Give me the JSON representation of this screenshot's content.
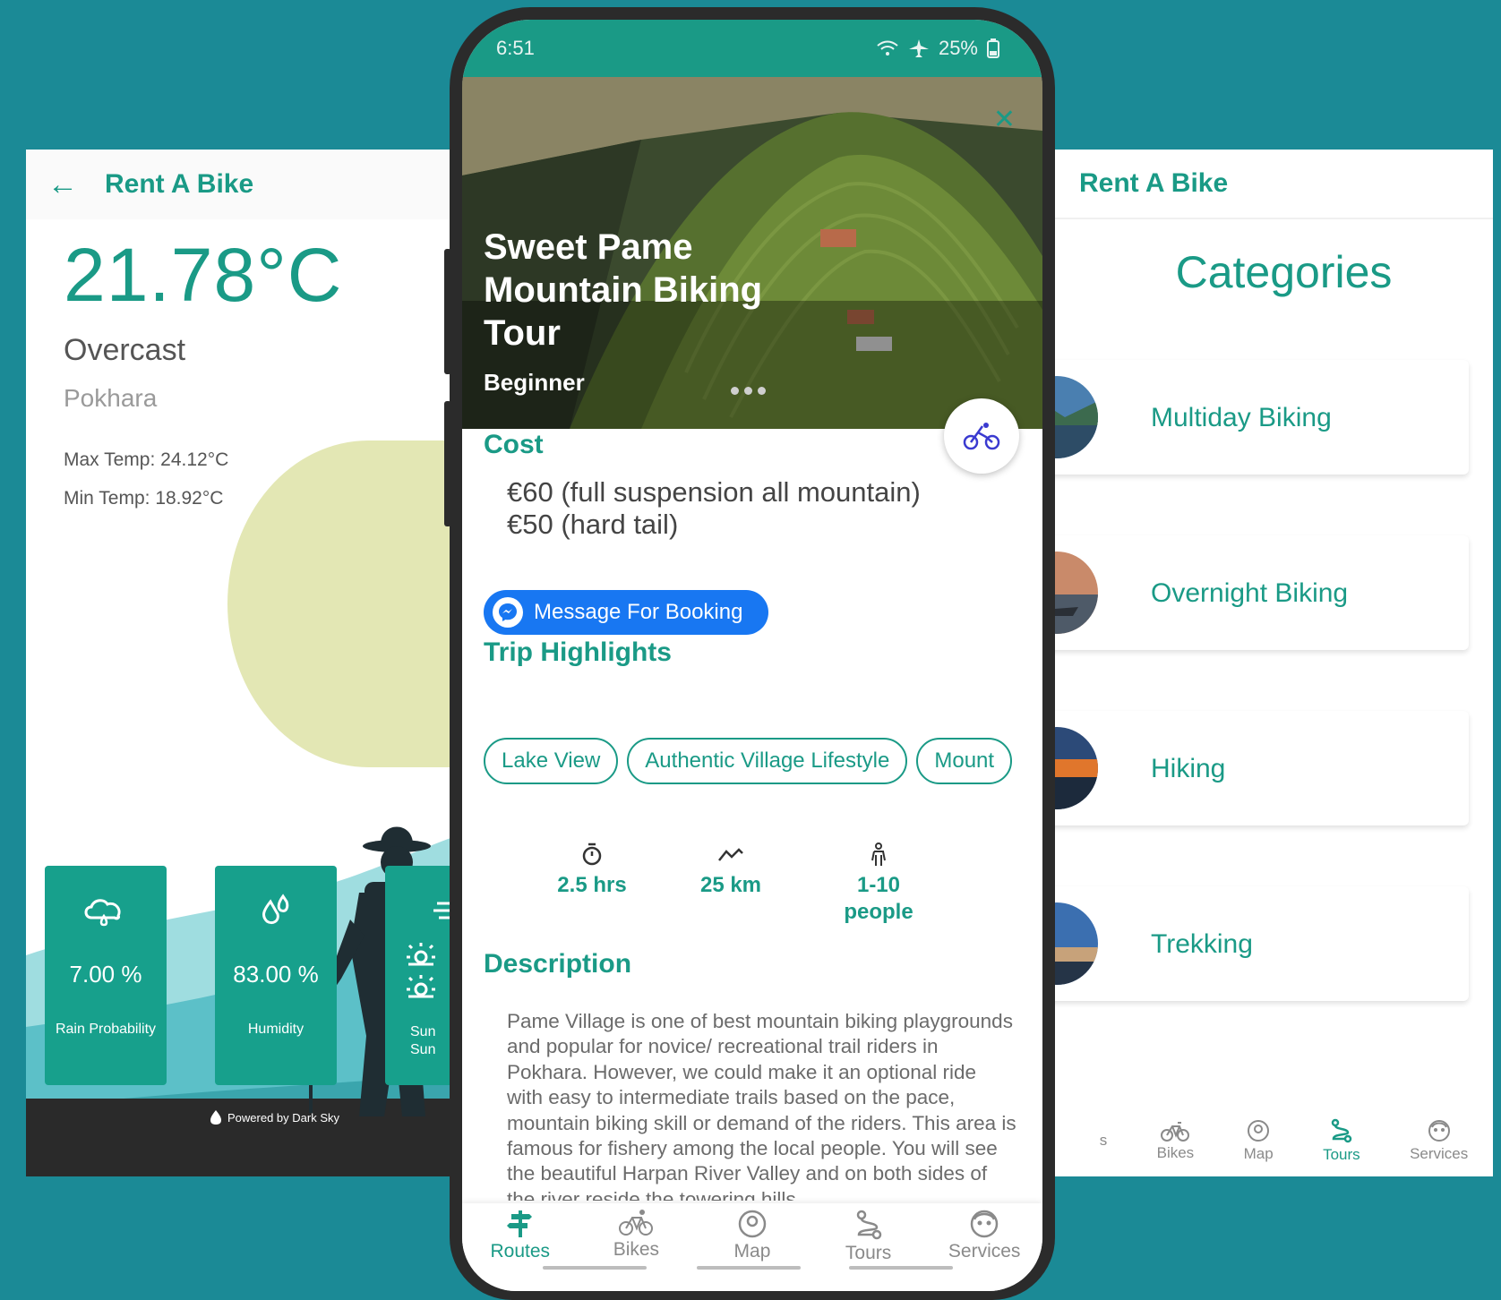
{
  "weather": {
    "header_title": "Rent A Bike",
    "temperature": "21.78°C",
    "condition": "Overcast",
    "city": "Pokhara",
    "max_temp": "Max Temp: 24.12°C",
    "min_temp": "Min Temp: 18.92°C",
    "cards": [
      {
        "value": "7.00 %",
        "label": "Rain Probability",
        "icon": "rain-cloud-icon"
      },
      {
        "value": "83.00 %",
        "label": "Humidity",
        "icon": "droplets-icon"
      },
      {
        "value": "",
        "label": "Sun Sun",
        "icon": "sunrise-sunset-icon"
      }
    ],
    "powered_by": "Powered by Dark Sky",
    "colors": {
      "accent": "#1a9a86",
      "sun": "#e3e7b4",
      "hill": "#5cc0c8",
      "ground": "#2a2a2a"
    }
  },
  "tour": {
    "status": {
      "time": "6:51",
      "battery": "25%"
    },
    "title": "Sweet Pame Mountain Biking Tour",
    "level": "Beginner",
    "cost_title": "Cost",
    "cost_lines": [
      "€60 (full suspension all mountain)",
      "€50 (hard tail)"
    ],
    "message_button": "Message For Booking",
    "highlights_title": "Trip Highlights",
    "highlights": [
      "Lake View",
      "Authentic Village Lifestyle",
      "Mount"
    ],
    "stats": {
      "duration": "2.5 hrs",
      "distance": "25 km",
      "group": "1-10 people"
    },
    "description_title": "Description",
    "description": "Pame Village is one of best mountain biking playgrounds and popular for novice/ recreational trail riders in Pokhara. However, we could make it an optional ride with easy to intermediate trails based on the pace, mountain biking skill or demand of the riders.  This area is famous for fishery among the local people. You will see the beautiful Harpan River Valley and on both sides of the river reside the towering hills",
    "nav": [
      "Routes",
      "Bikes",
      "Map",
      "Tours",
      "Services"
    ],
    "active_nav": "Routes",
    "colors": {
      "accent": "#1a9a86",
      "messenger": "#1877f2",
      "fab_icon": "#3a3ad0"
    }
  },
  "categories": {
    "header_title": "Rent A Bike",
    "title": "Categories",
    "items": [
      "Multiday Biking",
      "Overnight Biking",
      "Hiking",
      "Trekking"
    ],
    "nav": [
      "s",
      "Bikes",
      "Map",
      "Tours",
      "Services"
    ],
    "active_nav": "Tours"
  }
}
